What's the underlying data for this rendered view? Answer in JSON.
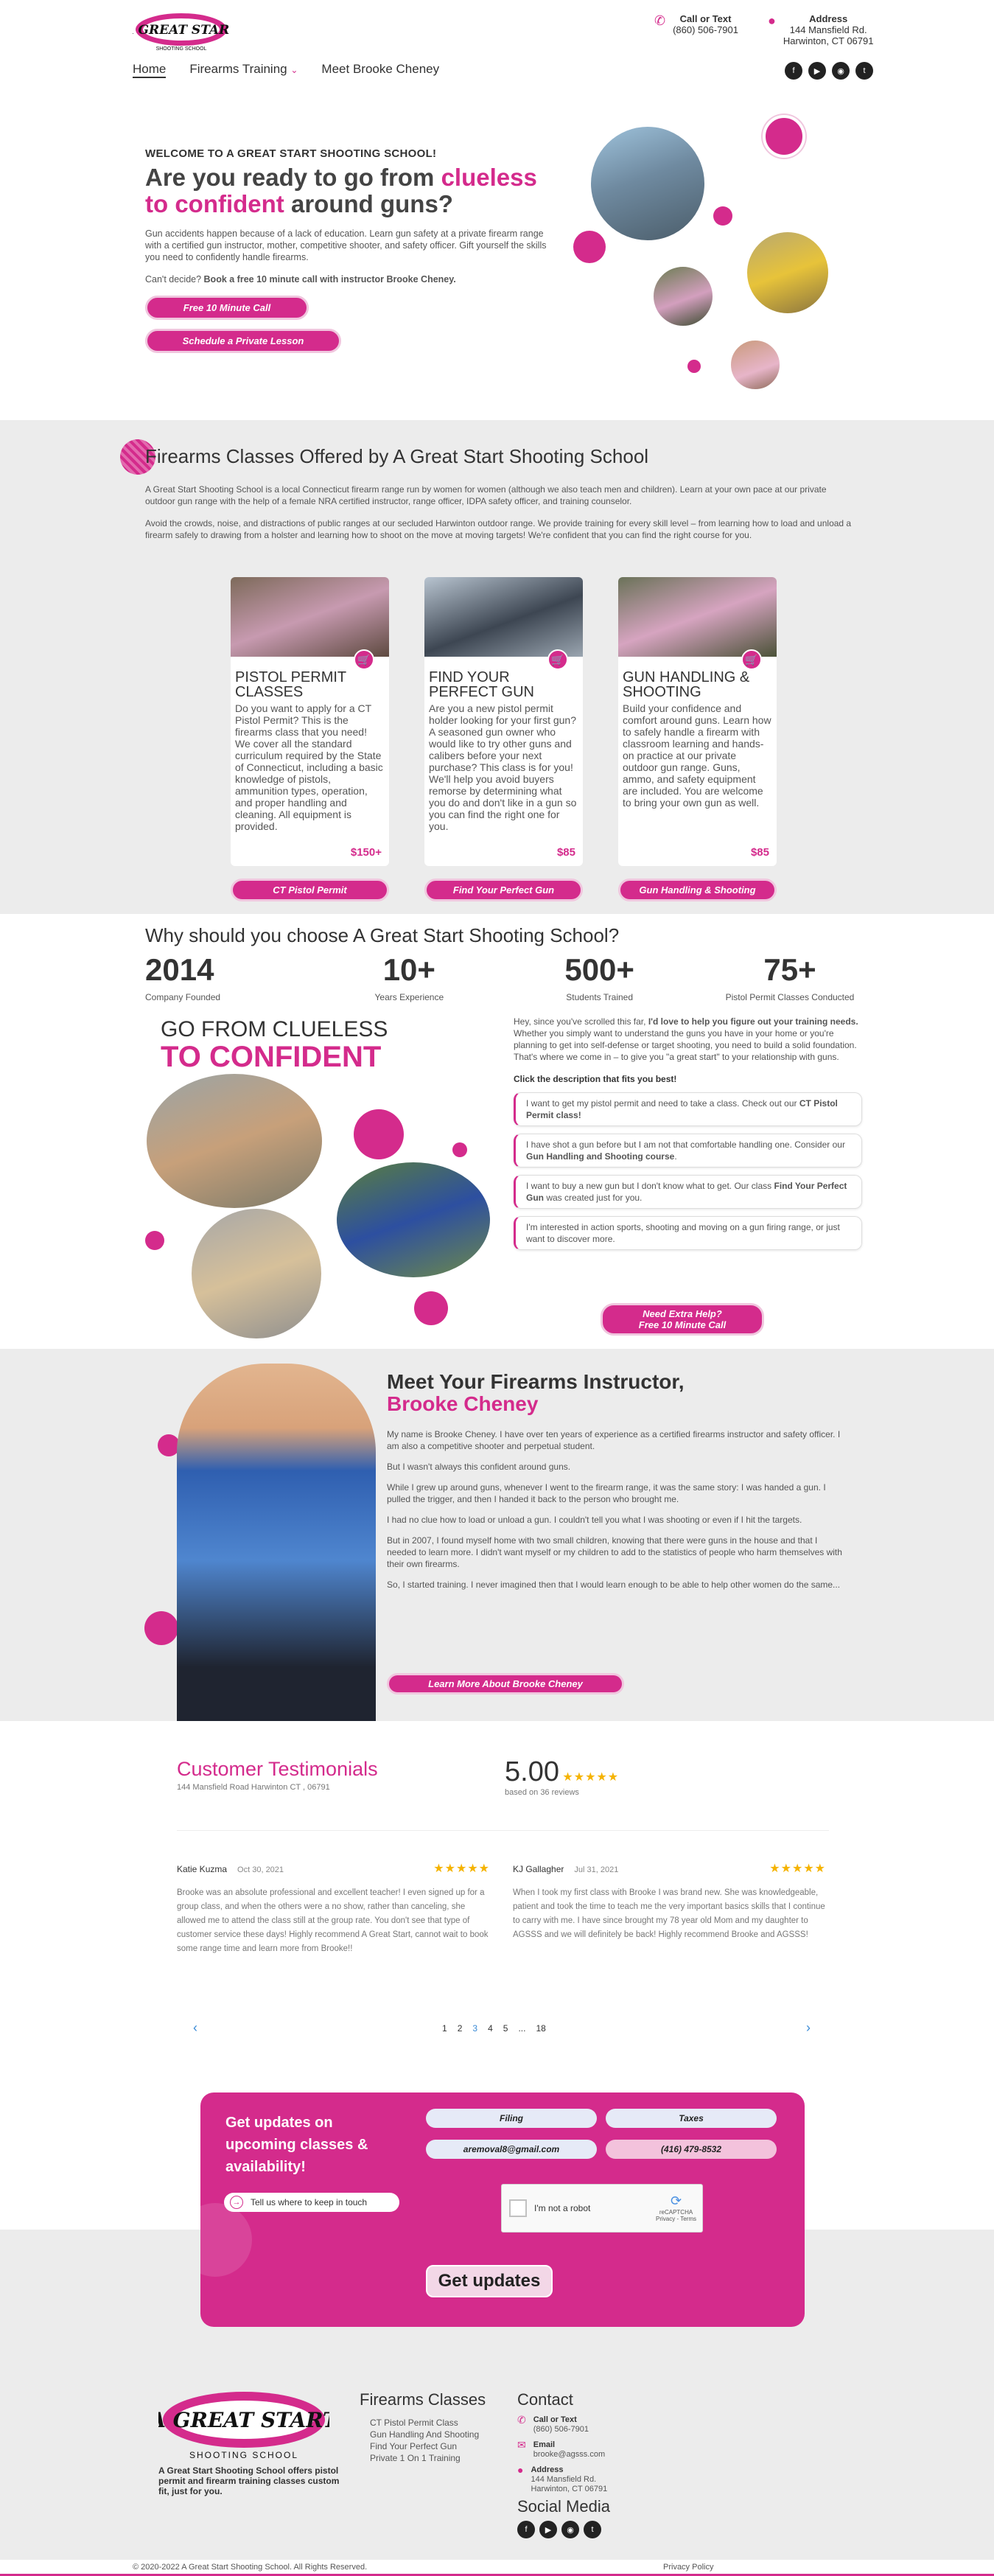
{
  "header": {
    "logo_text": "A GREAT START",
    "logo_sub": "SHOOTING SCHOOL",
    "nav": [
      "Home",
      "Firearms Training",
      "Meet Brooke Cheney"
    ],
    "call_label": "Call or Text",
    "phone": "(860) 506-7901",
    "address_label": "Address",
    "address_line1": "144 Mansfield Rd.",
    "address_line2": "Harwinton, CT 06791",
    "social": [
      "facebook-icon",
      "youtube-icon",
      "instagram-icon",
      "twitter-icon"
    ]
  },
  "hero": {
    "welcome": "WELCOME TO A GREAT START SHOOTING SCHOOL!",
    "h1_a": "Are you ready to go from ",
    "h1_b": "clueless to confident",
    "h1_c": " around guns?",
    "p1": "Gun accidents happen because of a lack of education. Learn gun safety at a private firearm range with a certified gun instructor, mother, competitive shooter, and safety officer. Gift yourself the skills you need to confidently handle firearms.",
    "p2_a": "Can't decide? ",
    "p2_b": "Book a free 10 minute call with instructor Brooke Cheney.",
    "btn1": "Free 10 Minute Call",
    "btn2": "Schedule a Private Lesson"
  },
  "classes": {
    "title": "Firearms Classes Offered by A Great Start Shooting School",
    "intro1": "A Great Start Shooting School is a local Connecticut firearm range run by women for women (although we also teach men and children). Learn at your own pace at our private outdoor gun range with the help of a female NRA certified instructor, range officer, IDPA safety officer, and training counselor.",
    "intro2": "Avoid the crowds, noise, and distractions of public ranges at our secluded Harwinton outdoor range. We provide training for every skill level – from learning how to load and unload a firearm safely to drawing from a holster and learning how to shoot on the move at moving targets! We're confident that you can find the right course for you.",
    "cards": [
      {
        "title": "PISTOL PERMIT CLASSES",
        "desc": "Do you want to apply for a CT Pistol Permit? This is the firearms class that you need! We cover all the standard curriculum required by the State of Connecticut, including a basic knowledge of pistols, ammunition types, operation, and proper handling and cleaning. All equipment is provided.",
        "price": "$150+",
        "button": "CT Pistol Permit"
      },
      {
        "title": "FIND YOUR PERFECT GUN",
        "desc": "Are you a new pistol permit holder looking for your first gun? A seasoned gun owner who would like to try other guns and calibers before your next purchase? This class is for you! We'll help you avoid buyers remorse by determining what you do and don't like in a gun so you can find the right one for you.",
        "price": "$85",
        "button": "Find Your Perfect Gun"
      },
      {
        "title": "GUN HANDLING & SHOOTING",
        "desc": "Build your confidence and comfort around guns. Learn how to safely handle a firearm with classroom learning and hands-on practice at our private outdoor gun range. Guns, ammo, and safety equipment are included. You are welcome to bring your own gun as well.",
        "price": "$85",
        "button": "Gun Handling & Shooting"
      }
    ]
  },
  "why": {
    "title": "Why should you choose A Great Start Shooting School?",
    "stats": [
      {
        "n": "2014",
        "l": "Company Founded"
      },
      {
        "n": "10+",
        "l": "Years Experience"
      },
      {
        "n": "500+",
        "l": "Students Trained"
      },
      {
        "n": "75+",
        "l": "Pistol Permit Classes Conducted"
      }
    ],
    "gfc_a": "GO FROM CLUELESS",
    "gfc_b": "TO CONFIDENT",
    "lead_a": "Hey, since you've scrolled this far, ",
    "lead_b": "I'd love to help you figure out your training needs.",
    "lead_c": " Whether you simply want to understand the guns you have in your home or you're planning to get into self-defense or target shooting, you need to build a solid foundation. That's where we come in – to give you \"a great start\" to your relationship with guns.",
    "click": "Click the description that fits you best!",
    "options": [
      {
        "a": "I want to get my pistol permit and need to take a class. Check out our ",
        "b": "CT Pistol Permit class!",
        "c": ""
      },
      {
        "a": "I have shot a gun before but I am not that comfortable handling one. Consider our ",
        "b": "Gun Handling and Shooting course",
        "c": "."
      },
      {
        "a": "I want to buy a new gun but I don't know what to get. Our class ",
        "b": "Find Your Perfect Gun",
        "c": " was created just for you."
      },
      {
        "a": "I'm interested in action sports, shooting and moving on a gun firing range, or just want to discover more.",
        "b": "",
        "c": ""
      }
    ],
    "btn_a": "Need Extra Help?",
    "btn_b": "Free 10 Minute Call"
  },
  "instructor": {
    "title_a": "Meet Your Firearms Instructor,",
    "title_b": "Brooke Cheney",
    "paras": [
      "My name is Brooke Cheney. I have over ten years of experience as a certified firearms instructor and safety officer. I am also a competitive shooter and perpetual student.",
      "But I wasn't always this confident around guns.",
      "While I grew up around guns, whenever I went to the firearm range, it was the same story: I was handed a gun. I pulled the trigger, and then I handed it back to the person who brought me.",
      "I had no clue how to load or unload a gun. I couldn't tell you what I was shooting or even if I hit the targets.",
      "But in 2007, I found myself home with two small children, knowing that there were guns in the house and that I needed to learn more. I didn't want myself or my children to add to the statistics of people who harm themselves with their own firearms.",
      "So, I started training. I never imagined then that I would learn enough to be able to help other women do the same..."
    ],
    "btn": "Learn More About Brooke Cheney"
  },
  "testimonials": {
    "title": "Customer Testimonials",
    "address": "144 Mansfield Road Harwinton CT , 06791",
    "score": "5.00",
    "stars": "★★★★★",
    "basis": "based on 36 reviews",
    "reviews": [
      {
        "name": "Katie Kuzma",
        "date": "Oct 30, 2021",
        "text": "Brooke was an absolute professional and excellent teacher! I even signed up for a group class, and when the others were a no show, rather than canceling, she allowed me to attend the class still at the group rate. You don't see that type of customer service these days! Highly recommend A Great Start, cannot wait to book some range time and learn more from Brooke!!"
      },
      {
        "name": "KJ Gallagher",
        "date": "Jul 31, 2021",
        "text": "When I took my first class with Brooke I was brand new. She was knowledgeable, patient and took the time to teach me the very important basics skills that I continue to carry with me. I have since brought my 78 year old Mom and my daughter to AGSSS and we will definitely be back! Highly recommend Brooke and AGSSS!"
      }
    ],
    "pages": [
      "1",
      "2",
      "3",
      "4",
      "5",
      "...",
      "18"
    ],
    "prev": "‹",
    "next": "›"
  },
  "signup": {
    "title": "Get updates on upcoming classes & availability!",
    "f1": "Filing",
    "f2": "Taxes",
    "f3": "aremoval8@gmail.com",
    "f4": "(416) 479-8532",
    "tellus": "Tell us where to keep in touch",
    "captcha": "I'm not a robot",
    "recaptcha": "reCAPTCHA",
    "recaptcha_sub": "Privacy - Terms",
    "btn": "Get updates"
  },
  "footer": {
    "tagline": "A Great Start Shooting School offers pistol permit and firearm training classes custom fit, just for you.",
    "classes_title": "Firearms Classes",
    "links": [
      "CT Pistol Permit Class",
      "Gun Handling And Shooting",
      "Find Your Perfect Gun",
      "Private 1 On 1 Training"
    ],
    "contact_title": "Contact",
    "call_label": "Call or Text",
    "phone": "(860) 506-7901",
    "email_label": "Email",
    "email": "brooke@agsss.com",
    "address_label": "Address",
    "addr1": "144 Mansfield Rd.",
    "addr2": "Harwinton, CT 06791",
    "social_title": "Social Media",
    "copyright": "© 2020-2022 A Great Start Shooting School. All Rights Reserved.",
    "privacy": "Privacy Policy"
  },
  "colors": {
    "accent": "#d42b8c",
    "grey_bg": "#ececec"
  }
}
